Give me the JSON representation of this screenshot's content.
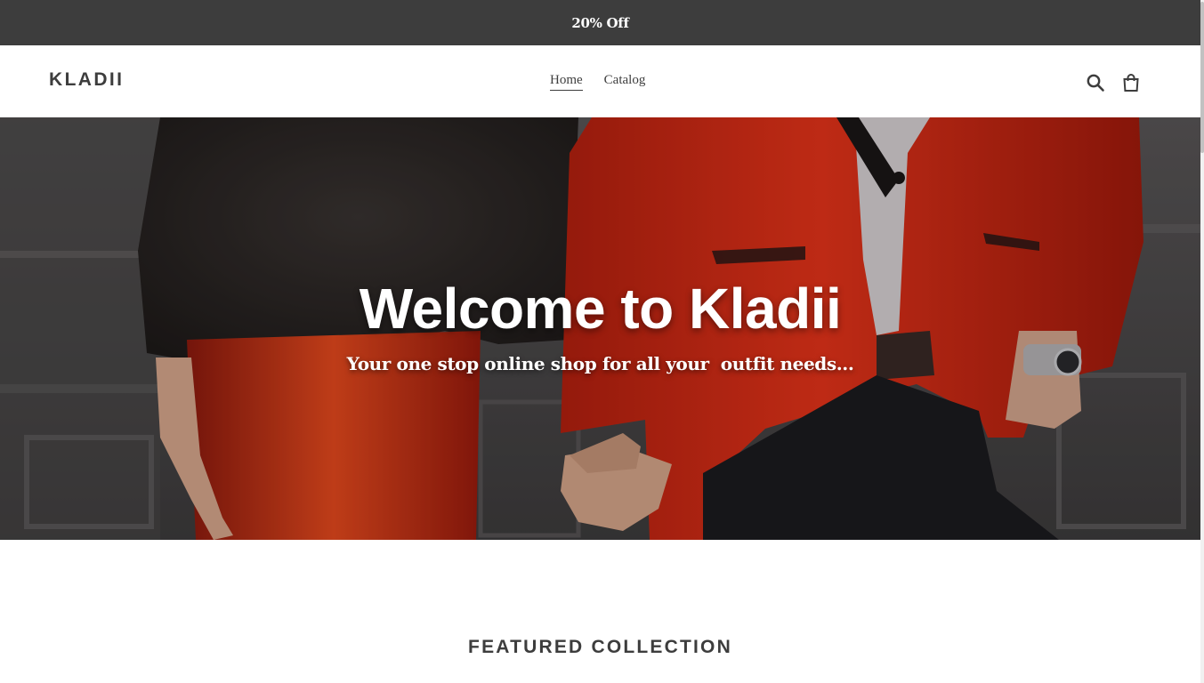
{
  "announcement": {
    "text": "20% Off"
  },
  "header": {
    "logo": "KLADII",
    "nav": [
      {
        "label": "Home",
        "active": true
      },
      {
        "label": "Catalog",
        "active": false
      }
    ],
    "icons": {
      "search": "search-icon",
      "cart": "cart-icon"
    }
  },
  "hero": {
    "title": "Welcome to Kladii",
    "subtitle": "Your one stop online shop for all your  outfit needs...",
    "image": "hero-image (couple holding hands, woman in fur top and red skirt, man in red blazer)"
  },
  "featured": {
    "heading": "FEATURED COLLECTION"
  },
  "colors": {
    "announcement_bg": "#3d3d3d",
    "text_dark": "#3d3d3d",
    "accent_red": "#d8301a",
    "background": "#ffffff"
  }
}
